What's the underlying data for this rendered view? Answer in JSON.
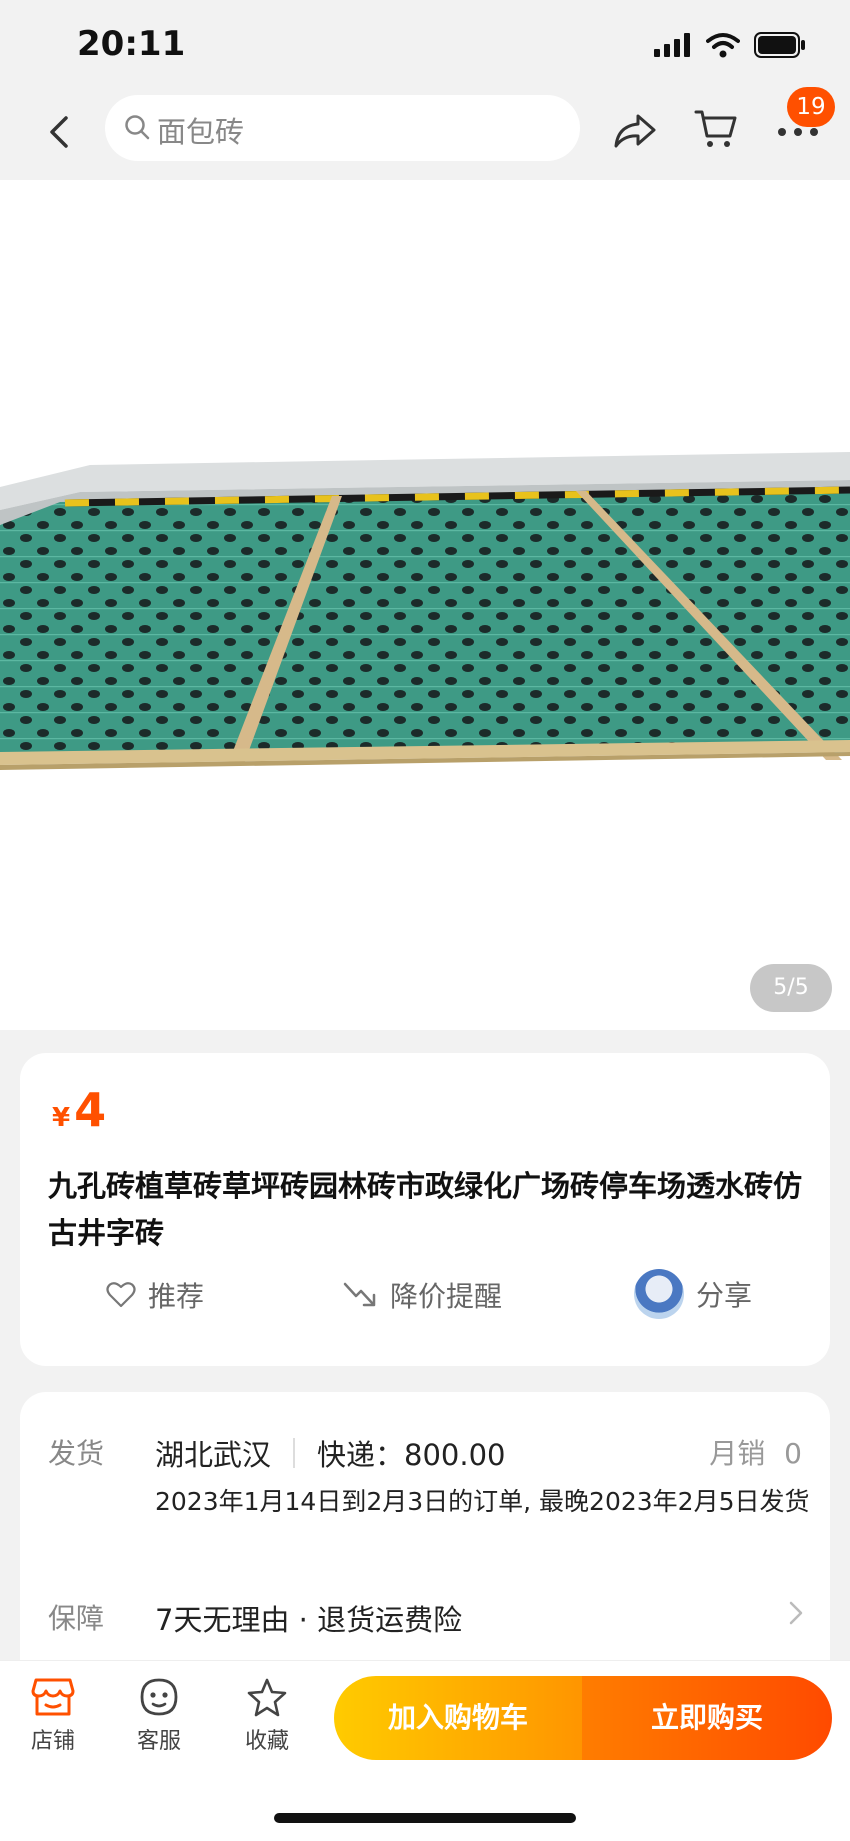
{
  "status_bar": {
    "time": "20:11"
  },
  "nav": {
    "search_placeholder": "面包砖",
    "cart_badge": "19"
  },
  "gallery": {
    "page_indicator": "5/5"
  },
  "product": {
    "currency": "¥",
    "price": "4",
    "title": "九孔砖植草砖草坪砖园林砖市政绿化广场砖停车场透水砖仿古井字砖",
    "actions": {
      "recommend": "推荐",
      "price_alert": "降价提醒",
      "share": "分享"
    }
  },
  "shipping": {
    "label": "发货",
    "origin": "湖北武汉",
    "express": "快递：800.00",
    "monthly_sales_label": "月销",
    "monthly_sales_value": "0",
    "note": "2023年1月14日到2月3日的订单, 最晚2023年2月5日发货",
    "guarantee_label": "保障",
    "guarantee_value": "7天无理由 · 退货运费险"
  },
  "bottom_bar": {
    "shop": "店铺",
    "service": "客服",
    "favorite": "收藏",
    "add_to_cart": "加入购物车",
    "buy_now": "立即购买"
  }
}
